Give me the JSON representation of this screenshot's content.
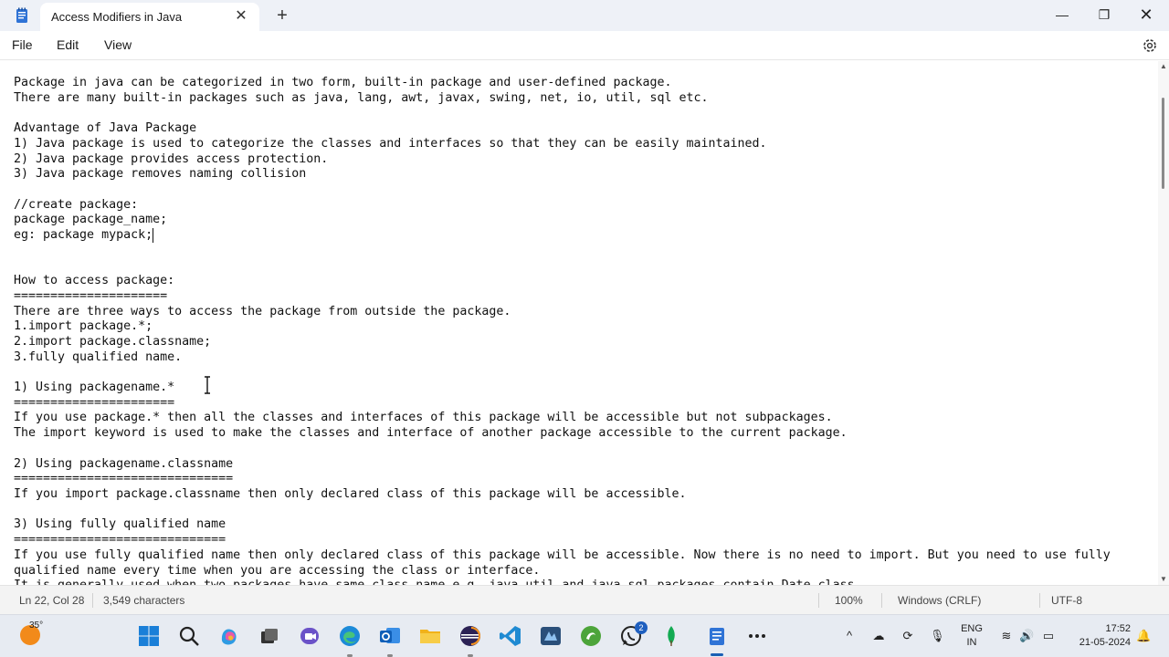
{
  "window": {
    "tab_title": "Access Modifiers in Java",
    "close_tab": "✕",
    "new_tab": "+",
    "minimize": "—",
    "maximize": "❐",
    "close": "✕"
  },
  "menu": {
    "file": "File",
    "edit": "Edit",
    "view": "View"
  },
  "editor": {
    "lines": [
      "Package in java can be categorized in two form, built-in package and user-defined package.",
      "There are many built-in packages such as java, lang, awt, javax, swing, net, io, util, sql etc.",
      "",
      "Advantage of Java Package",
      "1) Java package is used to categorize the classes and interfaces so that they can be easily maintained.",
      "2) Java package provides access protection.",
      "3) Java package removes naming collision",
      "",
      "//create package:",
      "package package_name;",
      "eg: package mypack;",
      "",
      "",
      "How to access package:",
      "=====================",
      "There are three ways to access the package from outside the package.",
      "1.import package.*;",
      "2.import package.classname;",
      "3.fully qualified name.",
      "",
      "1) Using packagename.*",
      "======================",
      "If you use package.* then all the classes and interfaces of this package will be accessible but not subpackages.",
      "The import keyword is used to make the classes and interface of another package accessible to the current package.",
      "",
      "2) Using packagename.classname",
      "==============================",
      "If you import package.classname then only declared class of this package will be accessible.",
      "",
      "3) Using fully qualified name",
      "=============================",
      "If you use fully qualified name then only declared class of this package will be accessible. Now there is no need to import. But you need to use fully",
      "qualified name every time when you are accessing the class or interface.",
      "It is generally used when two packages have same class name e.g. java.util and java.sql packages contain Date class."
    ]
  },
  "status": {
    "position": "Ln 22, Col 28",
    "characters": "3,549 characters",
    "zoom": "100%",
    "line_ending": "Windows (CRLF)",
    "encoding": "UTF-8"
  },
  "taskbar": {
    "temperature": "35°",
    "badge_count": "2",
    "language_1": "ENG",
    "language_2": "IN",
    "time": "17:52",
    "date": "21-05-2024",
    "tray_chevron": "^"
  }
}
